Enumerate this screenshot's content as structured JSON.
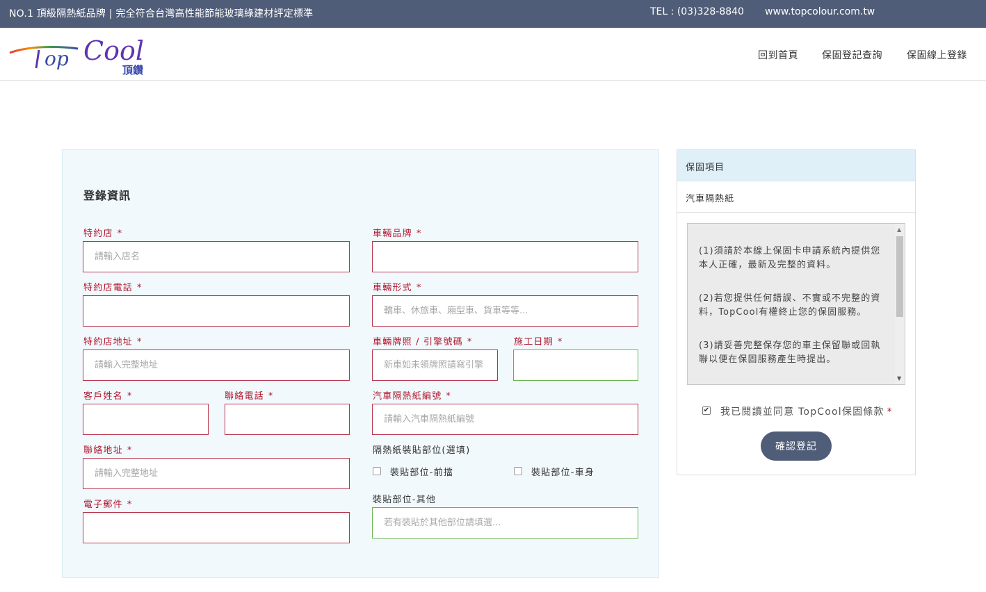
{
  "topbar": {
    "tagline": "NO.1 頂級隔熱紙品牌 | 完全符合台灣高性能節能玻璃綠建材評定標準",
    "tel": "TEL : (03)328-8840",
    "website": "www.topcolour.com.tw"
  },
  "brand": {
    "logo_text": "TopCool",
    "logo_subtext": "頂鑽"
  },
  "nav": {
    "home": "回到首頁",
    "query": "保固登記查詢",
    "register": "保固線上登錄"
  },
  "form": {
    "title": "登錄資訊",
    "required_mark": "*",
    "dealer": {
      "label": "特約店",
      "placeholder": "請輸入店名"
    },
    "dealer_phone": {
      "label": "特約店電話",
      "placeholder": ""
    },
    "dealer_address": {
      "label": "特約店地址",
      "placeholder": "請輸入完整地址"
    },
    "customer_name": {
      "label": "客戶姓名",
      "placeholder": ""
    },
    "contact_phone": {
      "label": "聯絡電話",
      "placeholder": ""
    },
    "contact_address": {
      "label": "聯絡地址",
      "placeholder": "請輸入完整地址"
    },
    "email": {
      "label": "電子郵件",
      "placeholder": ""
    },
    "car_brand": {
      "label": "車輛品牌",
      "placeholder": ""
    },
    "car_type": {
      "label": "車輛形式",
      "placeholder": "轎車、休旅車、廂型車、貨車等等..."
    },
    "plate": {
      "label": "車輛牌照 / 引擎號碼",
      "placeholder": "新車如未領牌照請寫引擎"
    },
    "install_date": {
      "label": "施工日期",
      "placeholder": ""
    },
    "film_no": {
      "label": "汽車隔熱紙編號",
      "placeholder": "請輸入汽車隔熱紙編號"
    },
    "position_title": "隔熱紙裝貼部位(選填)",
    "position_front": "裝貼部位-前擋",
    "position_body": "裝貼部位-車身",
    "position_other": {
      "label": "裝貼部位-其他",
      "placeholder": "若有裝貼於其他部位請填選..."
    }
  },
  "side": {
    "header": "保固項目",
    "item": "汽車隔熱紙",
    "terms": [
      "(1)須請於本線上保固卡申請系統內提供您本人正確，最新及完整的資料。",
      "(2)若您提供任何錯誤、不實或不完整的資料，TopCool有權終止您的保固服務。",
      "(3)請妥善完整保存您的車主保留聯或回執聯以便在保固服務產生時提出。"
    ],
    "agree_text": "我已閱讀並同意 TopCool保固條款",
    "agree_checked": true,
    "submit_label": "確認登記"
  }
}
